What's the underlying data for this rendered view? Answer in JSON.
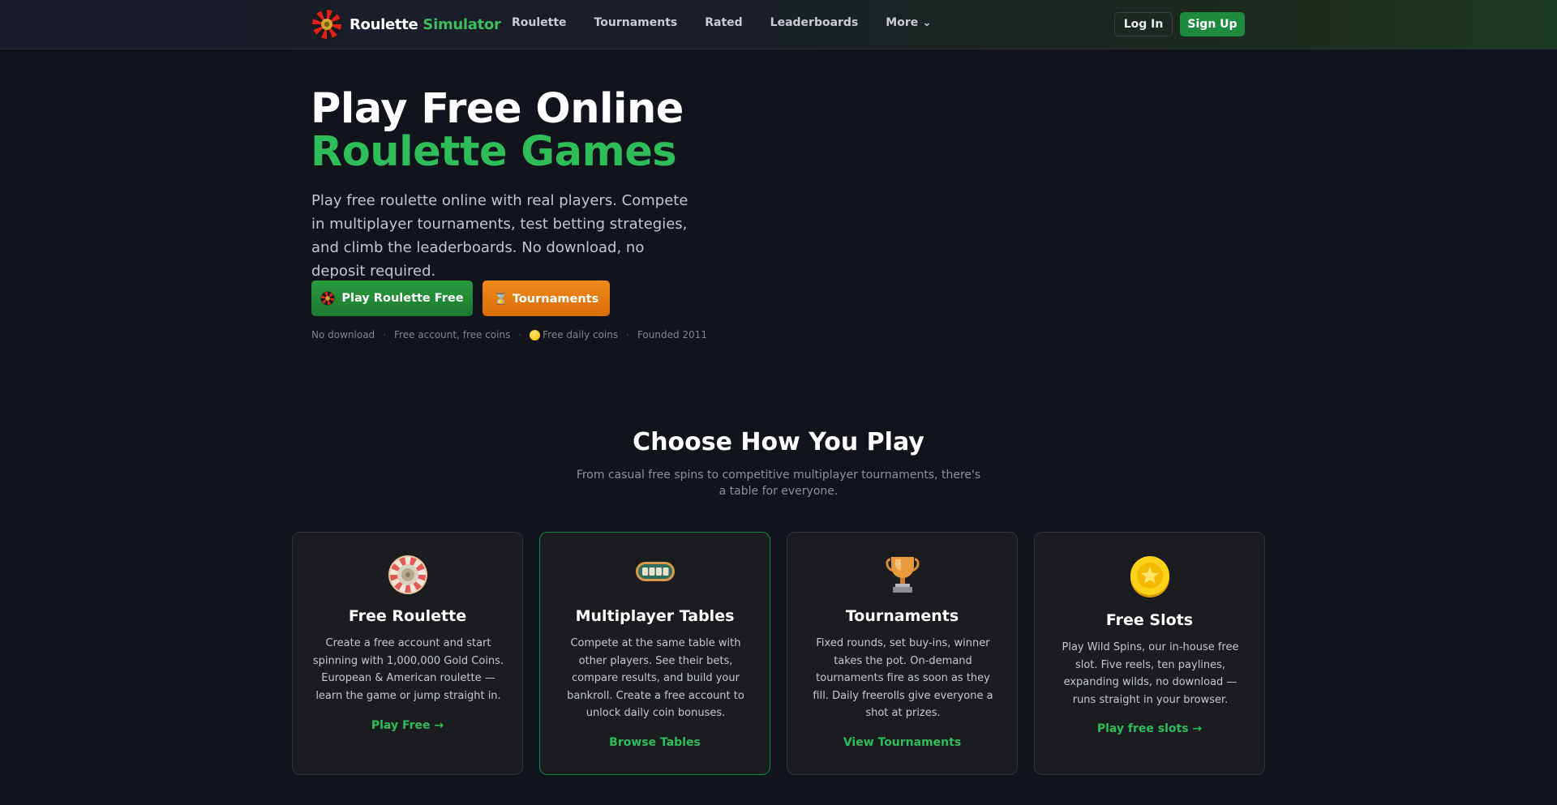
{
  "nav": {
    "logo_part1": "Roulette",
    "logo_part2": "Simulator",
    "links": [
      "Roulette",
      "Tournaments",
      "Rated",
      "Leaderboards",
      "More ⌄"
    ],
    "login": "Log In",
    "signup": "Sign Up"
  },
  "hero": {
    "title_line1": "Play Free Online",
    "title_line2": "Roulette Games",
    "subtitle": "Play free roulette online with real players. Compete in multiplayer tournaments, test betting strategies, and climb the leaderboards. No download, no deposit required.",
    "play_button": "Play Roulette Free",
    "tournaments_button": "⌛ Tournaments",
    "tags": [
      "No download",
      "Free account, free coins",
      "Free daily coins",
      "Founded 2011"
    ],
    "separator": "·"
  },
  "section": {
    "title": "Choose How You Play",
    "subtitle": "From casual free spins to competitive multiplayer tournaments, there's a table for everyone."
  },
  "cards": [
    {
      "icon": "roulette-wheel-icon",
      "title": "Free Roulette",
      "description": "Create a free account and start spinning with 1,000,000 Gold Coins. European & American roulette — learn the game or jump straight in.",
      "link": "Play Free →"
    },
    {
      "icon": "casino-chip-table-icon",
      "title": "Multiplayer Tables",
      "description": "Compete at the same table with other players. See their bets, compare results, and build your bankroll. Create a free account to unlock daily coin bonuses.",
      "link": "Browse Tables"
    },
    {
      "icon": "trophy-icon",
      "title": "Tournaments",
      "description": "Fixed rounds, set buy-ins, winner takes the pot. On-demand tournaments fire as soon as they fill. Daily freerolls give everyone a shot at prizes.",
      "link": "View Tournaments"
    },
    {
      "icon": "gold-coin-star-icon",
      "title": "Free Slots",
      "description": "Play Wild Spins, our in-house free slot. Five reels, ten paylines, expanding wilds, no download — runs straight in your browser.",
      "link": "Play free slots →"
    }
  ],
  "colors": {
    "brand_green": "#2fbd5a",
    "button_green": "#1e8a3d",
    "tournament_orange": "#f08a1a",
    "background": "#12141c",
    "card_background": "#1b1c20"
  }
}
